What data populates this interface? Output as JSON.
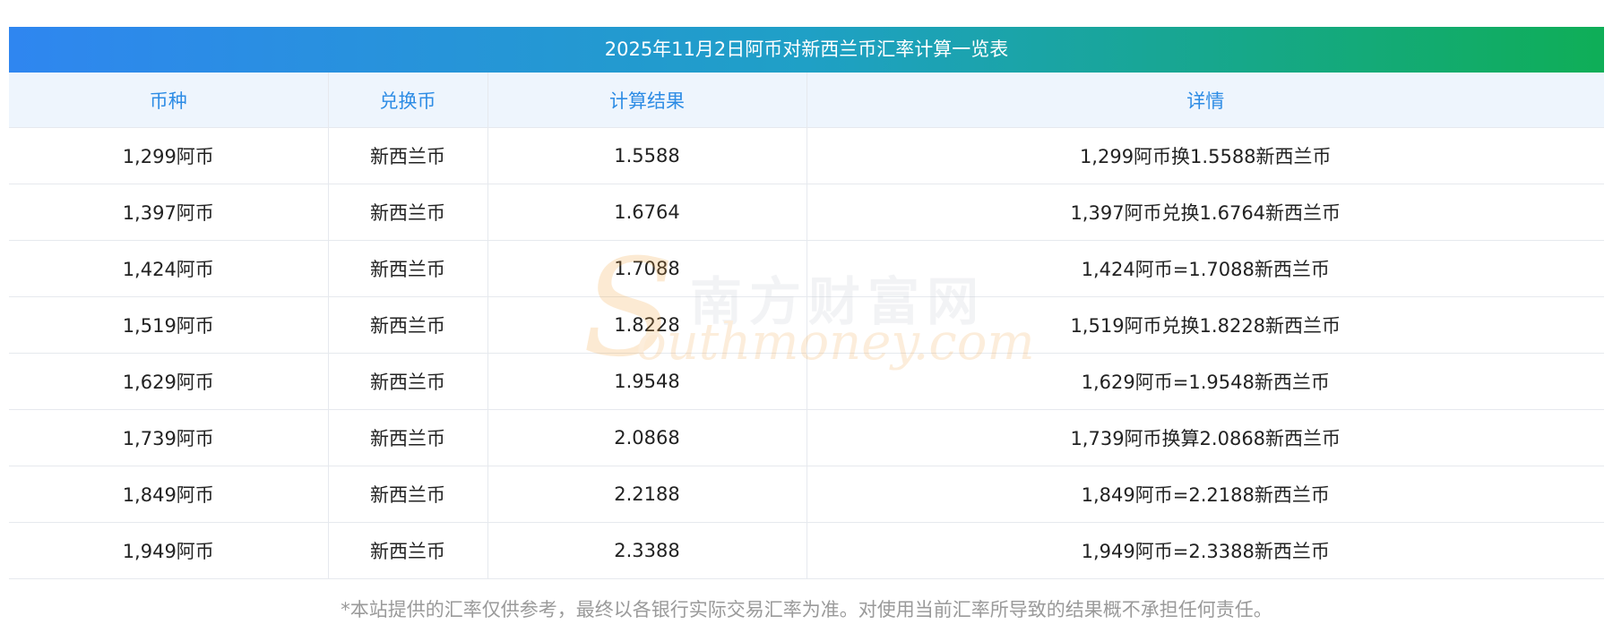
{
  "title": "2025年11月2日阿币对新西兰币汇率计算一览表",
  "headers": [
    "币种",
    "兑换币",
    "计算结果",
    "详情"
  ],
  "rows": [
    {
      "amount": "1,299阿币",
      "target": "新西兰币",
      "result": "1.5588",
      "detail": "1,299阿币换1.5588新西兰币"
    },
    {
      "amount": "1,397阿币",
      "target": "新西兰币",
      "result": "1.6764",
      "detail": "1,397阿币兑换1.6764新西兰币"
    },
    {
      "amount": "1,424阿币",
      "target": "新西兰币",
      "result": "1.7088",
      "detail": "1,424阿币=1.7088新西兰币"
    },
    {
      "amount": "1,519阿币",
      "target": "新西兰币",
      "result": "1.8228",
      "detail": "1,519阿币兑换1.8228新西兰币"
    },
    {
      "amount": "1,629阿币",
      "target": "新西兰币",
      "result": "1.9548",
      "detail": "1,629阿币=1.9548新西兰币"
    },
    {
      "amount": "1,739阿币",
      "target": "新西兰币",
      "result": "2.0868",
      "detail": "1,739阿币换算2.0868新西兰币"
    },
    {
      "amount": "1,849阿币",
      "target": "新西兰币",
      "result": "2.2188",
      "detail": "1,849阿币=2.2188新西兰币"
    },
    {
      "amount": "1,949阿币",
      "target": "新西兰币",
      "result": "2.3388",
      "detail": "1,949阿币=2.3388新西兰币"
    }
  ],
  "disclaimer": "*本站提供的汇率仅供参考，最终以各银行实际交易汇率为准。对使用当前汇率所导致的结果概不承担任何责任。",
  "watermark": {
    "cn": "南方财富网",
    "en_initial": "S",
    "en_rest": "outhmoney.com"
  },
  "colors": {
    "title_gradient_start": "#2f86f0",
    "title_gradient_end": "#0fae57",
    "header_text": "#2d8ce5",
    "header_bg": "#eef5fd"
  }
}
